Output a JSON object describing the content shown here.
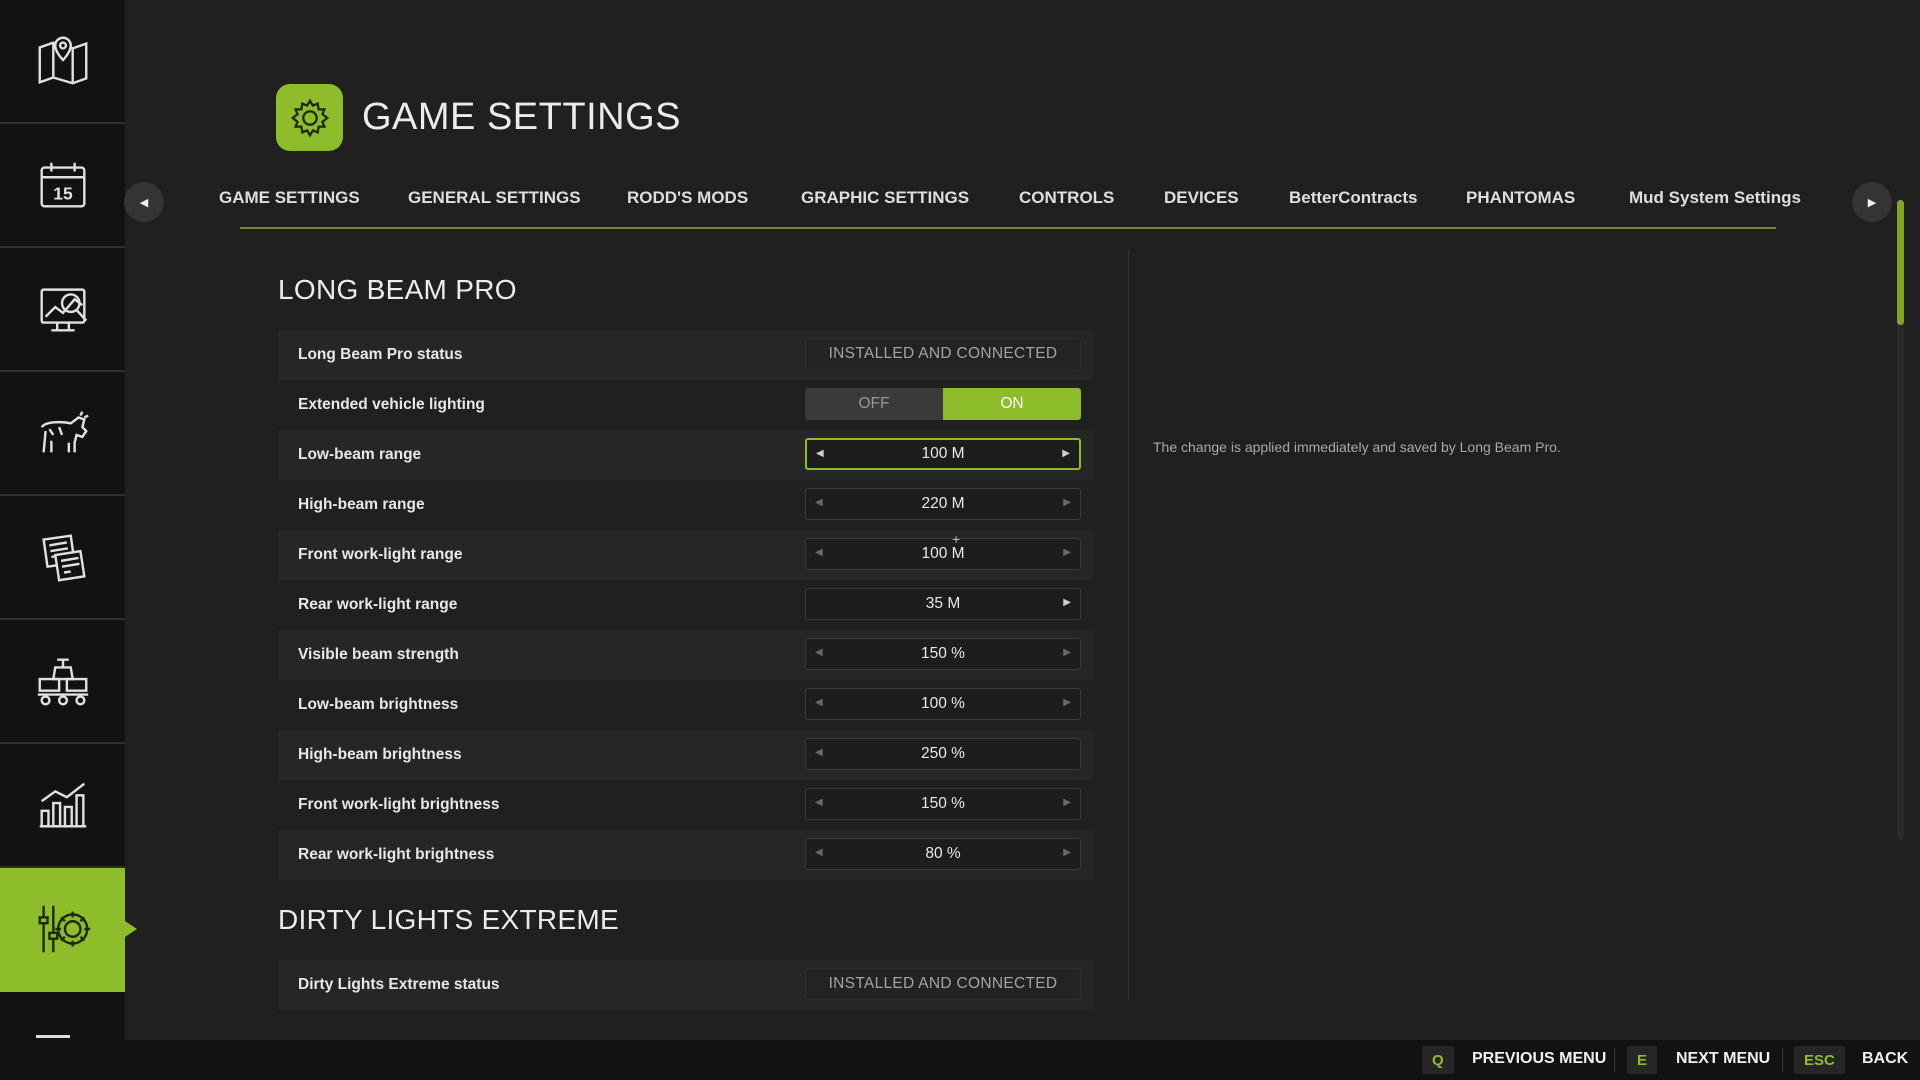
{
  "sidebar": {
    "items": [
      {
        "icon": "map-icon"
      },
      {
        "icon": "calendar-icon",
        "day": "15"
      },
      {
        "icon": "prices-chart-icon"
      },
      {
        "icon": "cow-icon"
      },
      {
        "icon": "contracts-icon"
      },
      {
        "icon": "production-icon"
      },
      {
        "icon": "statistics-icon"
      },
      {
        "icon": "settings-sliders-icon",
        "active": true
      }
    ]
  },
  "header": {
    "title": "GAME SETTINGS",
    "icon": "gear-icon"
  },
  "tabs": [
    {
      "label": "GAME SETTINGS"
    },
    {
      "label": "GENERAL SETTINGS"
    },
    {
      "label": "RODD'S MODS"
    },
    {
      "label": "GRAPHIC SETTINGS"
    },
    {
      "label": "CONTROLS"
    },
    {
      "label": "DEVICES"
    },
    {
      "label": "BetterContracts"
    },
    {
      "label": "PHANTOMAS"
    },
    {
      "label": "Mud System Settings"
    }
  ],
  "sections": {
    "lbp": {
      "title": "LONG BEAM PRO",
      "status_label": "Long Beam Pro status",
      "status_value": "INSTALLED AND CONNECTED",
      "ext_label": "Extended vehicle lighting",
      "ext_off": "OFF",
      "ext_on": "ON",
      "rows": [
        {
          "label": "Low-beam range",
          "value": "100 M"
        },
        {
          "label": "High-beam range",
          "value": "220 M"
        },
        {
          "label": "Front work-light range",
          "value": "100 M"
        },
        {
          "label": "Rear work-light range",
          "value": "35 M"
        },
        {
          "label": "Visible beam strength",
          "value": "150 %"
        },
        {
          "label": "Low-beam brightness",
          "value": "100 %"
        },
        {
          "label": "High-beam brightness",
          "value": "250 %"
        },
        {
          "label": "Front work-light brightness",
          "value": "150 %"
        },
        {
          "label": "Rear work-light brightness",
          "value": "80 %"
        }
      ]
    },
    "dle": {
      "title": "DIRTY LIGHTS EXTREME",
      "status_label": "Dirty Lights Extreme status",
      "status_value": "INSTALLED AND CONNECTED"
    }
  },
  "help_text": "The change is applied immediately and saved by Long Beam Pro.",
  "footer": {
    "prev_key": "Q",
    "prev_label": "PREVIOUS MENU",
    "next_key": "E",
    "next_label": "NEXT MENU",
    "back_key": "ESC",
    "back_label": "BACK"
  },
  "colors": {
    "accent": "#8ebd2b",
    "background": "#202020",
    "sidebar": "#121212"
  }
}
